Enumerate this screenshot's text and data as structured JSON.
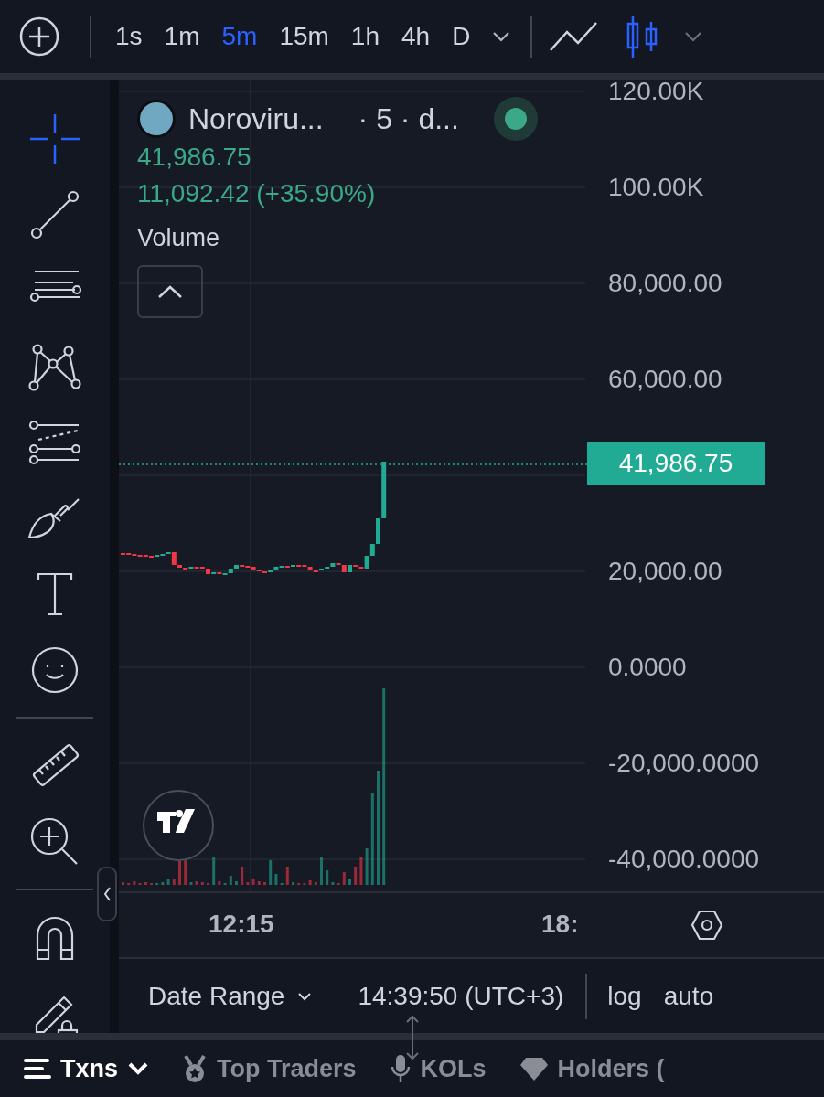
{
  "toolbar": {
    "intervals": [
      {
        "label": "1s",
        "selected": false
      },
      {
        "label": "1m",
        "selected": false
      },
      {
        "label": "5m",
        "selected": true
      },
      {
        "label": "15m",
        "selected": false
      },
      {
        "label": "1h",
        "selected": false
      },
      {
        "label": "4h",
        "selected": false
      },
      {
        "label": "D",
        "selected": false
      }
    ],
    "chart_types": [
      {
        "kind": "line",
        "selected": false
      },
      {
        "kind": "candles",
        "selected": true
      }
    ]
  },
  "tools": [
    {
      "kind": "crosshair",
      "selected": true
    },
    {
      "kind": "trend-line",
      "selected": false
    },
    {
      "kind": "channel",
      "selected": false
    },
    {
      "kind": "pattern",
      "selected": false
    },
    {
      "kind": "fib",
      "selected": false
    },
    {
      "kind": "brush",
      "selected": false
    },
    {
      "kind": "text",
      "selected": false
    },
    {
      "kind": "emoji",
      "selected": false
    },
    {
      "kind": "divider"
    },
    {
      "kind": "ruler",
      "selected": false
    },
    {
      "kind": "zoom",
      "selected": false
    },
    {
      "kind": "divider"
    },
    {
      "kind": "magnet",
      "selected": false
    },
    {
      "kind": "pencil-lock",
      "selected": false
    }
  ],
  "legend": {
    "symbol": "Noroviru...",
    "interval": "· 5 · d...",
    "live": true,
    "price": "41,986.75",
    "change": "11,092.42 (+35.90%)",
    "volume_label": "Volume"
  },
  "price_axis": {
    "labels": [
      "120.00K",
      "100.00K",
      "80,000.00",
      "60,000.00",
      "20,000.00",
      "0.0000",
      "-20,000.0000",
      "-40,000.0000"
    ],
    "current_price": "41,986.75"
  },
  "time_axis": {
    "labels": [
      "12:15",
      "18:"
    ]
  },
  "footer": {
    "date_range": "Date Range",
    "time": "14:39:50 (UTC+3)",
    "scale_options": [
      "log",
      "auto"
    ]
  },
  "tabs": [
    {
      "kind": "list",
      "label": "Txns",
      "selected": true
    },
    {
      "kind": "medal",
      "label": "Top Traders",
      "selected": false
    },
    {
      "kind": "mic",
      "label": "KOLs",
      "selected": false
    },
    {
      "kind": "diamond",
      "label": "Holders (",
      "selected": false
    }
  ]
}
